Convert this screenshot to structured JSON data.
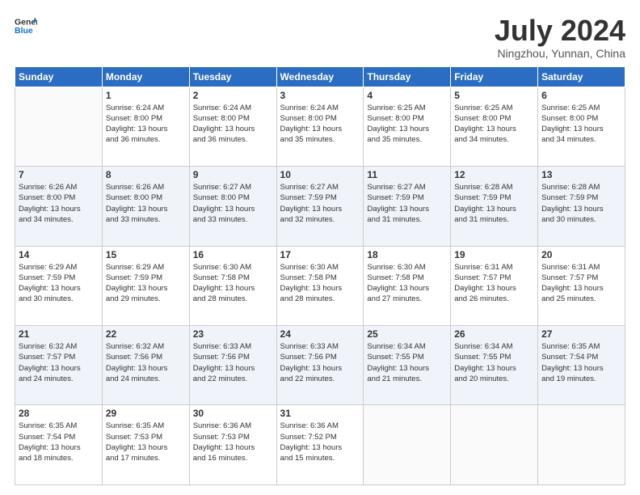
{
  "header": {
    "logo_line1": "General",
    "logo_line2": "Blue",
    "title": "July 2024",
    "location": "Ningzhou, Yunnan, China"
  },
  "days_of_week": [
    "Sunday",
    "Monday",
    "Tuesday",
    "Wednesday",
    "Thursday",
    "Friday",
    "Saturday"
  ],
  "weeks": [
    [
      {
        "day": "",
        "info": ""
      },
      {
        "day": "1",
        "info": "Sunrise: 6:24 AM\nSunset: 8:00 PM\nDaylight: 13 hours\nand 36 minutes."
      },
      {
        "day": "2",
        "info": "Sunrise: 6:24 AM\nSunset: 8:00 PM\nDaylight: 13 hours\nand 36 minutes."
      },
      {
        "day": "3",
        "info": "Sunrise: 6:24 AM\nSunset: 8:00 PM\nDaylight: 13 hours\nand 35 minutes."
      },
      {
        "day": "4",
        "info": "Sunrise: 6:25 AM\nSunset: 8:00 PM\nDaylight: 13 hours\nand 35 minutes."
      },
      {
        "day": "5",
        "info": "Sunrise: 6:25 AM\nSunset: 8:00 PM\nDaylight: 13 hours\nand 34 minutes."
      },
      {
        "day": "6",
        "info": "Sunrise: 6:25 AM\nSunset: 8:00 PM\nDaylight: 13 hours\nand 34 minutes."
      }
    ],
    [
      {
        "day": "7",
        "info": "Sunrise: 6:26 AM\nSunset: 8:00 PM\nDaylight: 13 hours\nand 34 minutes."
      },
      {
        "day": "8",
        "info": "Sunrise: 6:26 AM\nSunset: 8:00 PM\nDaylight: 13 hours\nand 33 minutes."
      },
      {
        "day": "9",
        "info": "Sunrise: 6:27 AM\nSunset: 8:00 PM\nDaylight: 13 hours\nand 33 minutes."
      },
      {
        "day": "10",
        "info": "Sunrise: 6:27 AM\nSunset: 7:59 PM\nDaylight: 13 hours\nand 32 minutes."
      },
      {
        "day": "11",
        "info": "Sunrise: 6:27 AM\nSunset: 7:59 PM\nDaylight: 13 hours\nand 31 minutes."
      },
      {
        "day": "12",
        "info": "Sunrise: 6:28 AM\nSunset: 7:59 PM\nDaylight: 13 hours\nand 31 minutes."
      },
      {
        "day": "13",
        "info": "Sunrise: 6:28 AM\nSunset: 7:59 PM\nDaylight: 13 hours\nand 30 minutes."
      }
    ],
    [
      {
        "day": "14",
        "info": "Sunrise: 6:29 AM\nSunset: 7:59 PM\nDaylight: 13 hours\nand 30 minutes."
      },
      {
        "day": "15",
        "info": "Sunrise: 6:29 AM\nSunset: 7:59 PM\nDaylight: 13 hours\nand 29 minutes."
      },
      {
        "day": "16",
        "info": "Sunrise: 6:30 AM\nSunset: 7:58 PM\nDaylight: 13 hours\nand 28 minutes."
      },
      {
        "day": "17",
        "info": "Sunrise: 6:30 AM\nSunset: 7:58 PM\nDaylight: 13 hours\nand 28 minutes."
      },
      {
        "day": "18",
        "info": "Sunrise: 6:30 AM\nSunset: 7:58 PM\nDaylight: 13 hours\nand 27 minutes."
      },
      {
        "day": "19",
        "info": "Sunrise: 6:31 AM\nSunset: 7:57 PM\nDaylight: 13 hours\nand 26 minutes."
      },
      {
        "day": "20",
        "info": "Sunrise: 6:31 AM\nSunset: 7:57 PM\nDaylight: 13 hours\nand 25 minutes."
      }
    ],
    [
      {
        "day": "21",
        "info": "Sunrise: 6:32 AM\nSunset: 7:57 PM\nDaylight: 13 hours\nand 24 minutes."
      },
      {
        "day": "22",
        "info": "Sunrise: 6:32 AM\nSunset: 7:56 PM\nDaylight: 13 hours\nand 24 minutes."
      },
      {
        "day": "23",
        "info": "Sunrise: 6:33 AM\nSunset: 7:56 PM\nDaylight: 13 hours\nand 22 minutes."
      },
      {
        "day": "24",
        "info": "Sunrise: 6:33 AM\nSunset: 7:56 PM\nDaylight: 13 hours\nand 22 minutes."
      },
      {
        "day": "25",
        "info": "Sunrise: 6:34 AM\nSunset: 7:55 PM\nDaylight: 13 hours\nand 21 minutes."
      },
      {
        "day": "26",
        "info": "Sunrise: 6:34 AM\nSunset: 7:55 PM\nDaylight: 13 hours\nand 20 minutes."
      },
      {
        "day": "27",
        "info": "Sunrise: 6:35 AM\nSunset: 7:54 PM\nDaylight: 13 hours\nand 19 minutes."
      }
    ],
    [
      {
        "day": "28",
        "info": "Sunrise: 6:35 AM\nSunset: 7:54 PM\nDaylight: 13 hours\nand 18 minutes."
      },
      {
        "day": "29",
        "info": "Sunrise: 6:35 AM\nSunset: 7:53 PM\nDaylight: 13 hours\nand 17 minutes."
      },
      {
        "day": "30",
        "info": "Sunrise: 6:36 AM\nSunset: 7:53 PM\nDaylight: 13 hours\nand 16 minutes."
      },
      {
        "day": "31",
        "info": "Sunrise: 6:36 AM\nSunset: 7:52 PM\nDaylight: 13 hours\nand 15 minutes."
      },
      {
        "day": "",
        "info": ""
      },
      {
        "day": "",
        "info": ""
      },
      {
        "day": "",
        "info": ""
      }
    ]
  ]
}
